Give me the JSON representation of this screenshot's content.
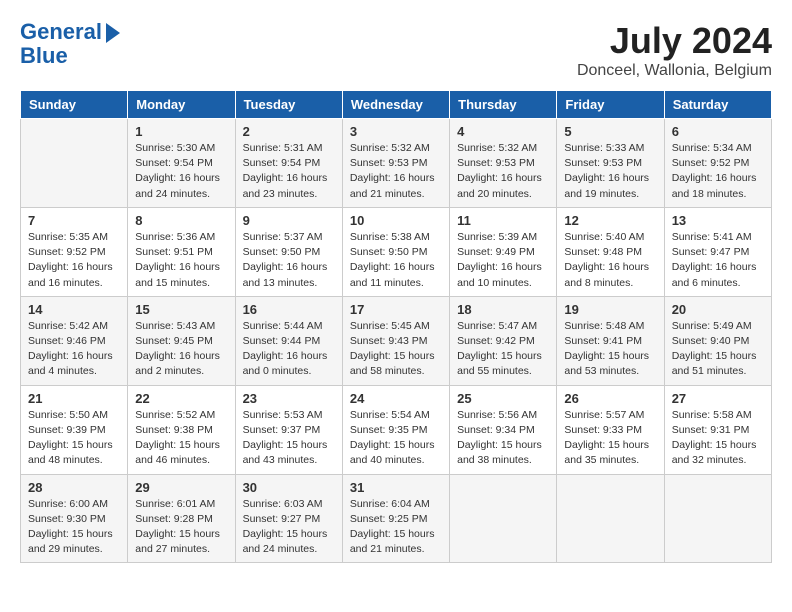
{
  "header": {
    "logo_line1": "General",
    "logo_line2": "Blue",
    "month_year": "July 2024",
    "location": "Donceel, Wallonia, Belgium"
  },
  "weekdays": [
    "Sunday",
    "Monday",
    "Tuesday",
    "Wednesday",
    "Thursday",
    "Friday",
    "Saturday"
  ],
  "weeks": [
    [
      {
        "day": "",
        "info": ""
      },
      {
        "day": "1",
        "info": "Sunrise: 5:30 AM\nSunset: 9:54 PM\nDaylight: 16 hours\nand 24 minutes."
      },
      {
        "day": "2",
        "info": "Sunrise: 5:31 AM\nSunset: 9:54 PM\nDaylight: 16 hours\nand 23 minutes."
      },
      {
        "day": "3",
        "info": "Sunrise: 5:32 AM\nSunset: 9:53 PM\nDaylight: 16 hours\nand 21 minutes."
      },
      {
        "day": "4",
        "info": "Sunrise: 5:32 AM\nSunset: 9:53 PM\nDaylight: 16 hours\nand 20 minutes."
      },
      {
        "day": "5",
        "info": "Sunrise: 5:33 AM\nSunset: 9:53 PM\nDaylight: 16 hours\nand 19 minutes."
      },
      {
        "day": "6",
        "info": "Sunrise: 5:34 AM\nSunset: 9:52 PM\nDaylight: 16 hours\nand 18 minutes."
      }
    ],
    [
      {
        "day": "7",
        "info": "Sunrise: 5:35 AM\nSunset: 9:52 PM\nDaylight: 16 hours\nand 16 minutes."
      },
      {
        "day": "8",
        "info": "Sunrise: 5:36 AM\nSunset: 9:51 PM\nDaylight: 16 hours\nand 15 minutes."
      },
      {
        "day": "9",
        "info": "Sunrise: 5:37 AM\nSunset: 9:50 PM\nDaylight: 16 hours\nand 13 minutes."
      },
      {
        "day": "10",
        "info": "Sunrise: 5:38 AM\nSunset: 9:50 PM\nDaylight: 16 hours\nand 11 minutes."
      },
      {
        "day": "11",
        "info": "Sunrise: 5:39 AM\nSunset: 9:49 PM\nDaylight: 16 hours\nand 10 minutes."
      },
      {
        "day": "12",
        "info": "Sunrise: 5:40 AM\nSunset: 9:48 PM\nDaylight: 16 hours\nand 8 minutes."
      },
      {
        "day": "13",
        "info": "Sunrise: 5:41 AM\nSunset: 9:47 PM\nDaylight: 16 hours\nand 6 minutes."
      }
    ],
    [
      {
        "day": "14",
        "info": "Sunrise: 5:42 AM\nSunset: 9:46 PM\nDaylight: 16 hours\nand 4 minutes."
      },
      {
        "day": "15",
        "info": "Sunrise: 5:43 AM\nSunset: 9:45 PM\nDaylight: 16 hours\nand 2 minutes."
      },
      {
        "day": "16",
        "info": "Sunrise: 5:44 AM\nSunset: 9:44 PM\nDaylight: 16 hours\nand 0 minutes."
      },
      {
        "day": "17",
        "info": "Sunrise: 5:45 AM\nSunset: 9:43 PM\nDaylight: 15 hours\nand 58 minutes."
      },
      {
        "day": "18",
        "info": "Sunrise: 5:47 AM\nSunset: 9:42 PM\nDaylight: 15 hours\nand 55 minutes."
      },
      {
        "day": "19",
        "info": "Sunrise: 5:48 AM\nSunset: 9:41 PM\nDaylight: 15 hours\nand 53 minutes."
      },
      {
        "day": "20",
        "info": "Sunrise: 5:49 AM\nSunset: 9:40 PM\nDaylight: 15 hours\nand 51 minutes."
      }
    ],
    [
      {
        "day": "21",
        "info": "Sunrise: 5:50 AM\nSunset: 9:39 PM\nDaylight: 15 hours\nand 48 minutes."
      },
      {
        "day": "22",
        "info": "Sunrise: 5:52 AM\nSunset: 9:38 PM\nDaylight: 15 hours\nand 46 minutes."
      },
      {
        "day": "23",
        "info": "Sunrise: 5:53 AM\nSunset: 9:37 PM\nDaylight: 15 hours\nand 43 minutes."
      },
      {
        "day": "24",
        "info": "Sunrise: 5:54 AM\nSunset: 9:35 PM\nDaylight: 15 hours\nand 40 minutes."
      },
      {
        "day": "25",
        "info": "Sunrise: 5:56 AM\nSunset: 9:34 PM\nDaylight: 15 hours\nand 38 minutes."
      },
      {
        "day": "26",
        "info": "Sunrise: 5:57 AM\nSunset: 9:33 PM\nDaylight: 15 hours\nand 35 minutes."
      },
      {
        "day": "27",
        "info": "Sunrise: 5:58 AM\nSunset: 9:31 PM\nDaylight: 15 hours\nand 32 minutes."
      }
    ],
    [
      {
        "day": "28",
        "info": "Sunrise: 6:00 AM\nSunset: 9:30 PM\nDaylight: 15 hours\nand 29 minutes."
      },
      {
        "day": "29",
        "info": "Sunrise: 6:01 AM\nSunset: 9:28 PM\nDaylight: 15 hours\nand 27 minutes."
      },
      {
        "day": "30",
        "info": "Sunrise: 6:03 AM\nSunset: 9:27 PM\nDaylight: 15 hours\nand 24 minutes."
      },
      {
        "day": "31",
        "info": "Sunrise: 6:04 AM\nSunset: 9:25 PM\nDaylight: 15 hours\nand 21 minutes."
      },
      {
        "day": "",
        "info": ""
      },
      {
        "day": "",
        "info": ""
      },
      {
        "day": "",
        "info": ""
      }
    ]
  ]
}
